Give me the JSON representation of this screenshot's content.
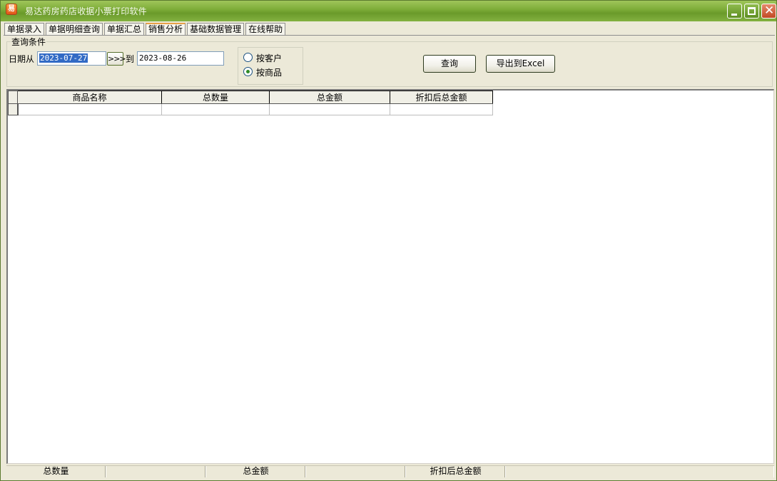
{
  "window": {
    "title": "易达药房药店收据小票打印软件",
    "app_icon_glyph": "易",
    "controls": {
      "minimize": "minimize-icon",
      "maximize": "maximize-icon",
      "close": "close-icon"
    },
    "close_glyph": "✕"
  },
  "tabs": [
    {
      "label": "单据录入",
      "active": false
    },
    {
      "label": "单据明细查询",
      "active": false
    },
    {
      "label": "单据汇总",
      "active": false
    },
    {
      "label": "销售分析",
      "active": true
    },
    {
      "label": "基础数据管理",
      "active": false
    },
    {
      "label": "在线帮助",
      "active": false
    }
  ],
  "query": {
    "group_label": "查询条件",
    "date_from_label": "日期从",
    "date_from": "2023-07-27",
    "arrow_button": ">>>",
    "date_to_label": "到",
    "date_to": "2023-08-26",
    "radio_options": [
      {
        "label": "按客户",
        "checked": false
      },
      {
        "label": "按商品",
        "checked": true
      }
    ],
    "query_button": "查询",
    "export_button": "导出到Excel"
  },
  "grid": {
    "columns": [
      "商品名称",
      "总数量",
      "总金额",
      "折扣后总金额"
    ],
    "rows": [
      [
        "",
        "",
        "",
        ""
      ]
    ]
  },
  "footer": {
    "cells": [
      "总数量",
      "",
      "总金额",
      "",
      "折扣后总金额"
    ]
  },
  "colors": {
    "titlebar": "#7FAE3A",
    "active_tab_accent": "#E8A047",
    "date_selection": "#316AC5",
    "window_background": "#ECE9D8"
  }
}
